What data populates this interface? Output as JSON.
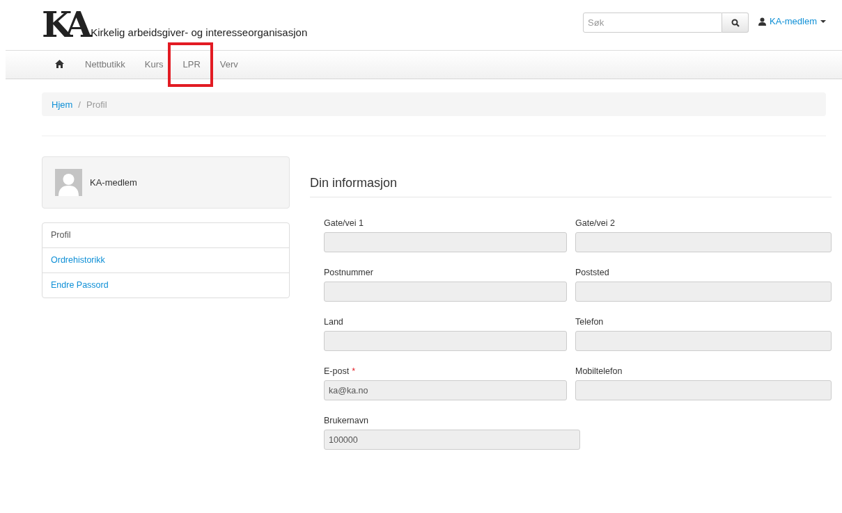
{
  "header": {
    "logo": "KA",
    "tagline": "Kirkelig arbeidsgiver- og interesseorganisasjon",
    "search": {
      "placeholder": "Søk"
    },
    "user_menu": "KA-medlem"
  },
  "nav": [
    {
      "kind": "home",
      "highlighted": false
    },
    {
      "label": "Nettbutikk",
      "highlighted": false
    },
    {
      "label": "Kurs",
      "highlighted": false
    },
    {
      "label": "LPR",
      "highlighted": true
    },
    {
      "label": "Verv",
      "highlighted": false
    }
  ],
  "breadcrumb": {
    "separator": "/",
    "items": [
      {
        "label": "Hjem",
        "link": true
      },
      {
        "label": "Profil",
        "link": false
      }
    ]
  },
  "profile_card": {
    "name": "KA-medlem"
  },
  "profile_menu": [
    {
      "label": "Profil",
      "selected": true
    },
    {
      "label": "Ordrehistorikk",
      "selected": false
    },
    {
      "label": "Endre Passord",
      "selected": false
    }
  ],
  "form": {
    "title": "Din informasjon",
    "fields": [
      {
        "label": "Gate/vei 1"
      },
      {
        "label": "Gate/vei 2"
      },
      {
        "label": "Postnummer"
      },
      {
        "label": "Poststed"
      },
      {
        "label": "Land"
      },
      {
        "label": "Telefon"
      },
      {
        "label": "E-post",
        "required_mark": "*",
        "value": "ka@ka.no"
      },
      {
        "label": "Mobiltelefon"
      },
      {
        "label": "Brukernavn",
        "value": "100000"
      }
    ]
  }
}
